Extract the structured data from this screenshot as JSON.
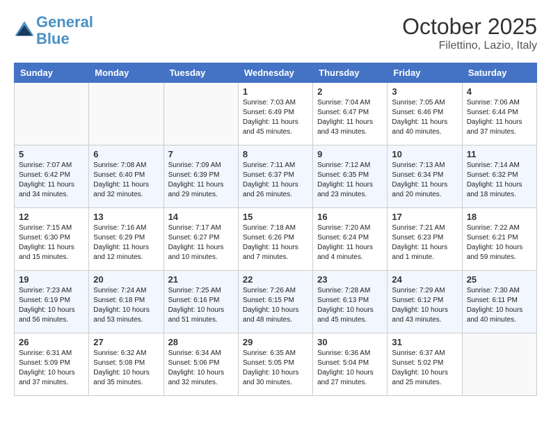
{
  "header": {
    "logo_line1": "General",
    "logo_line2": "Blue",
    "month": "October 2025",
    "location": "Filettino, Lazio, Italy"
  },
  "weekdays": [
    "Sunday",
    "Monday",
    "Tuesday",
    "Wednesday",
    "Thursday",
    "Friday",
    "Saturday"
  ],
  "weeks": [
    [
      {
        "day": "",
        "sunrise": "",
        "sunset": "",
        "daylight": ""
      },
      {
        "day": "",
        "sunrise": "",
        "sunset": "",
        "daylight": ""
      },
      {
        "day": "",
        "sunrise": "",
        "sunset": "",
        "daylight": ""
      },
      {
        "day": "1",
        "sunrise": "Sunrise: 7:03 AM",
        "sunset": "Sunset: 6:49 PM",
        "daylight": "Daylight: 11 hours and 45 minutes."
      },
      {
        "day": "2",
        "sunrise": "Sunrise: 7:04 AM",
        "sunset": "Sunset: 6:47 PM",
        "daylight": "Daylight: 11 hours and 43 minutes."
      },
      {
        "day": "3",
        "sunrise": "Sunrise: 7:05 AM",
        "sunset": "Sunset: 6:46 PM",
        "daylight": "Daylight: 11 hours and 40 minutes."
      },
      {
        "day": "4",
        "sunrise": "Sunrise: 7:06 AM",
        "sunset": "Sunset: 6:44 PM",
        "daylight": "Daylight: 11 hours and 37 minutes."
      }
    ],
    [
      {
        "day": "5",
        "sunrise": "Sunrise: 7:07 AM",
        "sunset": "Sunset: 6:42 PM",
        "daylight": "Daylight: 11 hours and 34 minutes."
      },
      {
        "day": "6",
        "sunrise": "Sunrise: 7:08 AM",
        "sunset": "Sunset: 6:40 PM",
        "daylight": "Daylight: 11 hours and 32 minutes."
      },
      {
        "day": "7",
        "sunrise": "Sunrise: 7:09 AM",
        "sunset": "Sunset: 6:39 PM",
        "daylight": "Daylight: 11 hours and 29 minutes."
      },
      {
        "day": "8",
        "sunrise": "Sunrise: 7:11 AM",
        "sunset": "Sunset: 6:37 PM",
        "daylight": "Daylight: 11 hours and 26 minutes."
      },
      {
        "day": "9",
        "sunrise": "Sunrise: 7:12 AM",
        "sunset": "Sunset: 6:35 PM",
        "daylight": "Daylight: 11 hours and 23 minutes."
      },
      {
        "day": "10",
        "sunrise": "Sunrise: 7:13 AM",
        "sunset": "Sunset: 6:34 PM",
        "daylight": "Daylight: 11 hours and 20 minutes."
      },
      {
        "day": "11",
        "sunrise": "Sunrise: 7:14 AM",
        "sunset": "Sunset: 6:32 PM",
        "daylight": "Daylight: 11 hours and 18 minutes."
      }
    ],
    [
      {
        "day": "12",
        "sunrise": "Sunrise: 7:15 AM",
        "sunset": "Sunset: 6:30 PM",
        "daylight": "Daylight: 11 hours and 15 minutes."
      },
      {
        "day": "13",
        "sunrise": "Sunrise: 7:16 AM",
        "sunset": "Sunset: 6:29 PM",
        "daylight": "Daylight: 11 hours and 12 minutes."
      },
      {
        "day": "14",
        "sunrise": "Sunrise: 7:17 AM",
        "sunset": "Sunset: 6:27 PM",
        "daylight": "Daylight: 11 hours and 10 minutes."
      },
      {
        "day": "15",
        "sunrise": "Sunrise: 7:18 AM",
        "sunset": "Sunset: 6:26 PM",
        "daylight": "Daylight: 11 hours and 7 minutes."
      },
      {
        "day": "16",
        "sunrise": "Sunrise: 7:20 AM",
        "sunset": "Sunset: 6:24 PM",
        "daylight": "Daylight: 11 hours and 4 minutes."
      },
      {
        "day": "17",
        "sunrise": "Sunrise: 7:21 AM",
        "sunset": "Sunset: 6:23 PM",
        "daylight": "Daylight: 11 hours and 1 minute."
      },
      {
        "day": "18",
        "sunrise": "Sunrise: 7:22 AM",
        "sunset": "Sunset: 6:21 PM",
        "daylight": "Daylight: 10 hours and 59 minutes."
      }
    ],
    [
      {
        "day": "19",
        "sunrise": "Sunrise: 7:23 AM",
        "sunset": "Sunset: 6:19 PM",
        "daylight": "Daylight: 10 hours and 56 minutes."
      },
      {
        "day": "20",
        "sunrise": "Sunrise: 7:24 AM",
        "sunset": "Sunset: 6:18 PM",
        "daylight": "Daylight: 10 hours and 53 minutes."
      },
      {
        "day": "21",
        "sunrise": "Sunrise: 7:25 AM",
        "sunset": "Sunset: 6:16 PM",
        "daylight": "Daylight: 10 hours and 51 minutes."
      },
      {
        "day": "22",
        "sunrise": "Sunrise: 7:26 AM",
        "sunset": "Sunset: 6:15 PM",
        "daylight": "Daylight: 10 hours and 48 minutes."
      },
      {
        "day": "23",
        "sunrise": "Sunrise: 7:28 AM",
        "sunset": "Sunset: 6:13 PM",
        "daylight": "Daylight: 10 hours and 45 minutes."
      },
      {
        "day": "24",
        "sunrise": "Sunrise: 7:29 AM",
        "sunset": "Sunset: 6:12 PM",
        "daylight": "Daylight: 10 hours and 43 minutes."
      },
      {
        "day": "25",
        "sunrise": "Sunrise: 7:30 AM",
        "sunset": "Sunset: 6:11 PM",
        "daylight": "Daylight: 10 hours and 40 minutes."
      }
    ],
    [
      {
        "day": "26",
        "sunrise": "Sunrise: 6:31 AM",
        "sunset": "Sunset: 5:09 PM",
        "daylight": "Daylight: 10 hours and 37 minutes."
      },
      {
        "day": "27",
        "sunrise": "Sunrise: 6:32 AM",
        "sunset": "Sunset: 5:08 PM",
        "daylight": "Daylight: 10 hours and 35 minutes."
      },
      {
        "day": "28",
        "sunrise": "Sunrise: 6:34 AM",
        "sunset": "Sunset: 5:06 PM",
        "daylight": "Daylight: 10 hours and 32 minutes."
      },
      {
        "day": "29",
        "sunrise": "Sunrise: 6:35 AM",
        "sunset": "Sunset: 5:05 PM",
        "daylight": "Daylight: 10 hours and 30 minutes."
      },
      {
        "day": "30",
        "sunrise": "Sunrise: 6:36 AM",
        "sunset": "Sunset: 5:04 PM",
        "daylight": "Daylight: 10 hours and 27 minutes."
      },
      {
        "day": "31",
        "sunrise": "Sunrise: 6:37 AM",
        "sunset": "Sunset: 5:02 PM",
        "daylight": "Daylight: 10 hours and 25 minutes."
      },
      {
        "day": "",
        "sunrise": "",
        "sunset": "",
        "daylight": ""
      }
    ]
  ]
}
